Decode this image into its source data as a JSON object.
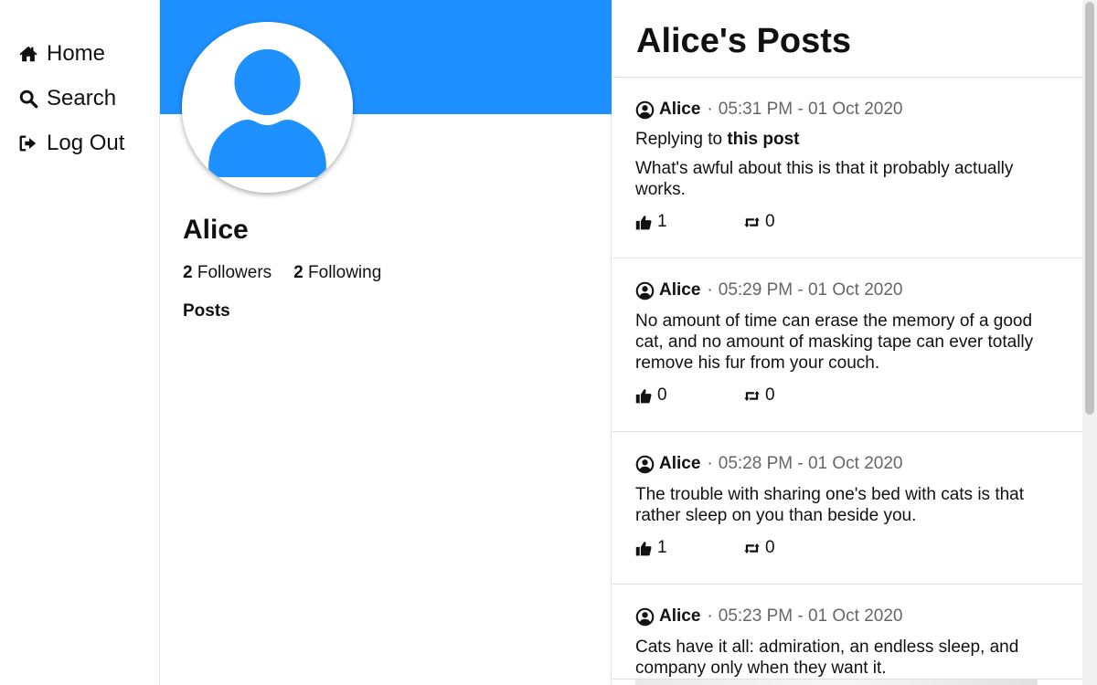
{
  "nav": [
    {
      "label": "Home",
      "icon": "home-icon"
    },
    {
      "label": "Search",
      "icon": "search-icon"
    },
    {
      "label": "Log Out",
      "icon": "logout-icon"
    }
  ],
  "profile": {
    "name": "Alice",
    "followers_count": "2",
    "followers_label": "Followers",
    "following_count": "2",
    "following_label": "Following",
    "posts_tab": "Posts",
    "banner_color": "#1e90ff"
  },
  "feed": {
    "title": "Alice's Posts",
    "posts": [
      {
        "author": "Alice",
        "time": "05:31 PM - 01 Oct 2020",
        "reply_prefix": "Replying to",
        "reply_target": "this post",
        "text": "What's awful about this is that it probably actually works.",
        "likes": "1",
        "reposts": "0"
      },
      {
        "author": "Alice",
        "time": "05:29 PM - 01 Oct 2020",
        "text": "No amount of time can erase the memory of a good cat, and no amount of masking tape can ever totally remove his fur from your couch.",
        "likes": "0",
        "reposts": "0"
      },
      {
        "author": "Alice",
        "time": "05:28 PM - 01 Oct 2020",
        "text": "The trouble with sharing one's bed with cats is that rather sleep on you than beside you.",
        "likes": "1",
        "reposts": "0"
      },
      {
        "author": "Alice",
        "time": "05:23 PM - 01 Oct 2020",
        "text": "Cats have it all: admiration, an endless sleep, and company only when they want it.",
        "likes": "",
        "reposts": ""
      }
    ]
  }
}
